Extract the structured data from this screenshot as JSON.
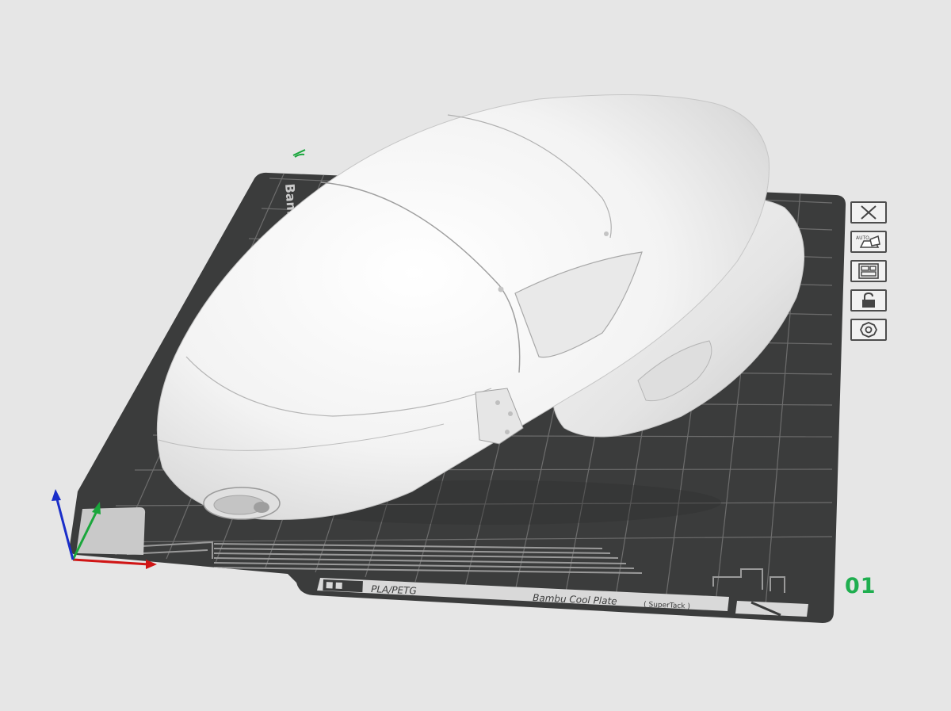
{
  "plate": {
    "number": "01",
    "number_color": "#1fae4f",
    "brand_text": "Bambu",
    "filament_label": "PLA/PETG",
    "plate_type_label": "Bambu Cool Plate",
    "plate_variant_label": "( SuperTack )"
  },
  "toolbar": {
    "buttons": [
      {
        "name": "close-plate-button",
        "icon": "close-icon"
      },
      {
        "name": "auto-orient-button",
        "icon": "auto-orient-icon",
        "badge": "AUTO"
      },
      {
        "name": "arrange-button",
        "icon": "arrange-icon"
      },
      {
        "name": "lock-plate-button",
        "icon": "lock-icon"
      },
      {
        "name": "plate-settings-button",
        "icon": "gear-icon"
      }
    ]
  },
  "colors": {
    "background": "#e6e6e6",
    "plate": "#3b3c3c",
    "grid": "#6a6a6a",
    "model": "#f2f2f2",
    "axis_x": "#d01515",
    "axis_y": "#1aa63c",
    "axis_z": "#1a2ec9",
    "accent": "#1fae4f"
  }
}
